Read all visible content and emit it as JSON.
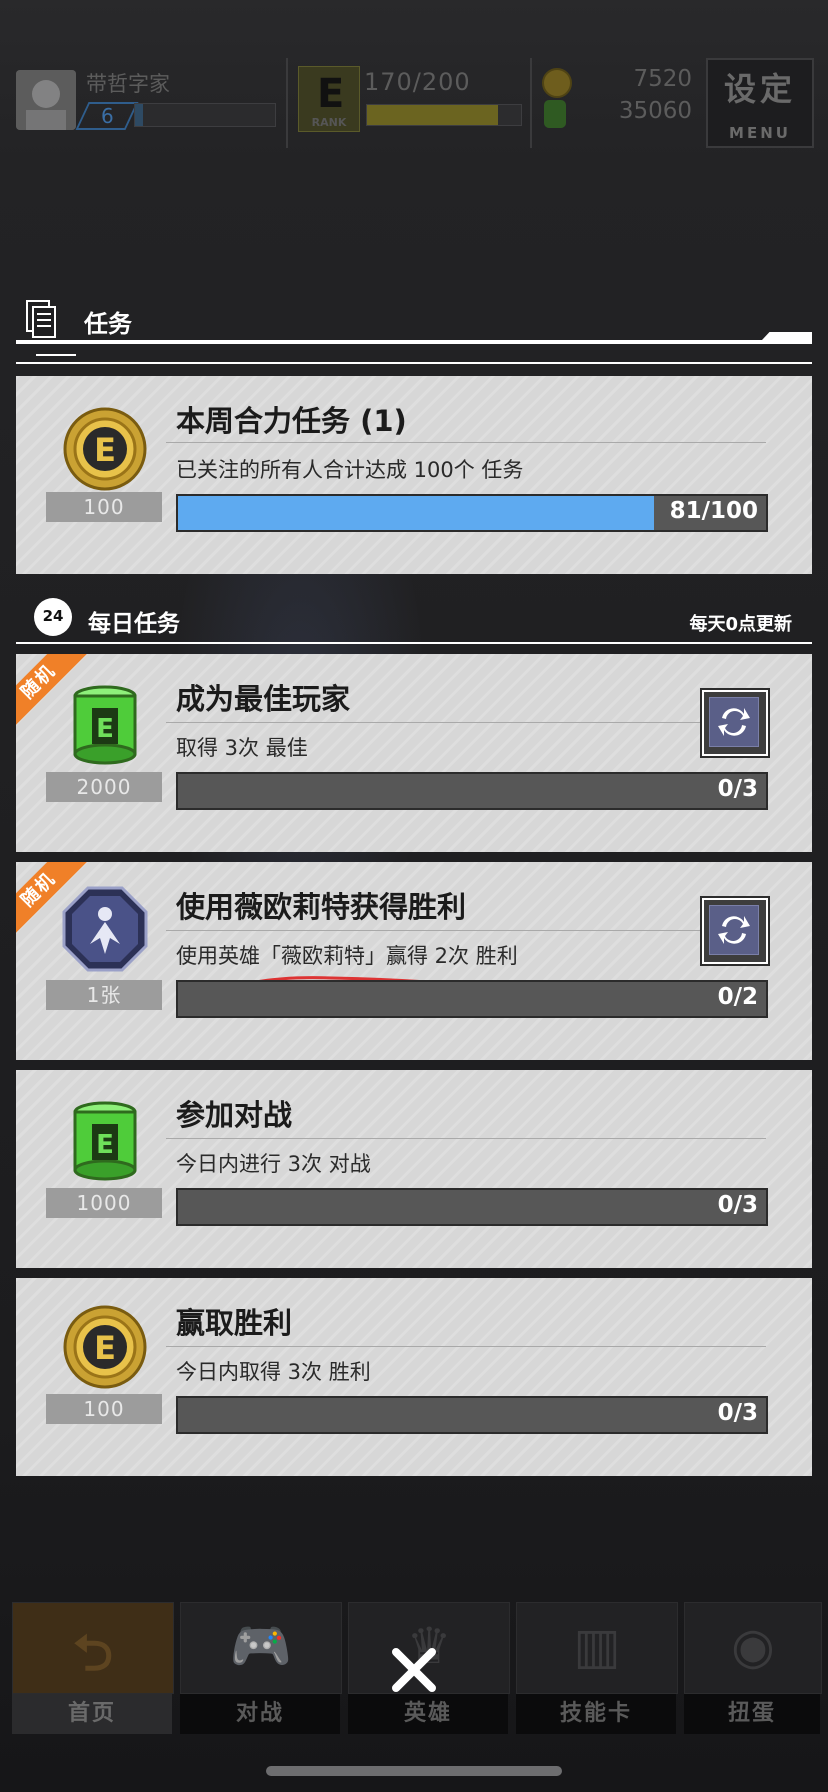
{
  "topbar": {
    "username": "带哲字家",
    "level": "6",
    "rank_letter": "E",
    "rank_label": "RANK",
    "stamina": "170/200",
    "stamina_fraction": 0.85,
    "gold": "7520",
    "green_currency": "35060",
    "settings_label": "设定",
    "settings_sub": "MENU"
  },
  "section": {
    "title": "任务"
  },
  "weekly_task": {
    "title": "本周合力任务 (1)",
    "description": "已关注的所有人合计达成 100个 任务",
    "reward_amount": "100",
    "reward_icon": "gold-coin-icon",
    "progress_text": "81/100",
    "progress_fraction": 0.81
  },
  "daily": {
    "badge": "24",
    "title": "每日任务",
    "reset_note": "每天0点更新",
    "tasks": [
      {
        "title": "成为最佳玩家",
        "description": "取得 3次 最佳",
        "reward_amount": "2000",
        "reward_icon": "green-barrel-icon",
        "progress_text": "0/3",
        "badge": "随机"
      },
      {
        "title": "使用薇欧莉特获得胜利",
        "description": "使用英雄「薇欧莉特」赢得 2次 胜利",
        "reward_amount": "1张",
        "reward_icon": "hero-card-icon",
        "progress_text": "0/2",
        "badge": "随机"
      },
      {
        "title": "参加对战",
        "description": "今日内进行 3次 对战",
        "reward_amount": "1000",
        "reward_icon": "green-barrel-icon",
        "progress_text": "0/3"
      },
      {
        "title": "赢取胜利",
        "description": "今日内取得 3次 胜利",
        "reward_amount": "100",
        "reward_icon": "gold-coin-icon",
        "progress_text": "0/3"
      }
    ]
  },
  "nav": {
    "items": [
      {
        "label": "首页"
      },
      {
        "label": "对战"
      },
      {
        "label": "英雄"
      },
      {
        "label": "技能卡"
      },
      {
        "label": "扭蛋"
      }
    ]
  },
  "colors": {
    "progress_blue": "#5eaaf0",
    "random_badge": "#f08028",
    "card_bg": "#d7d7d7"
  }
}
